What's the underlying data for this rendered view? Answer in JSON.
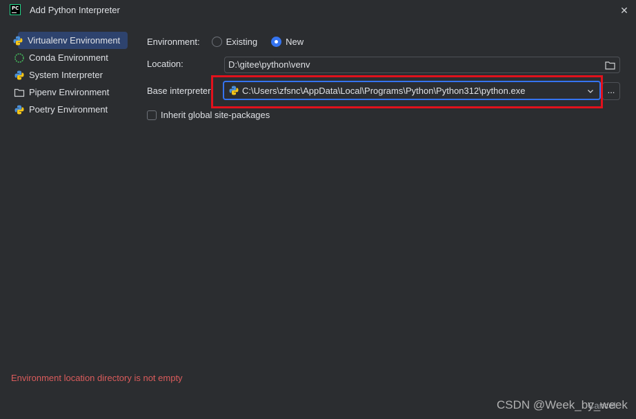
{
  "window": {
    "title": "Add Python Interpreter",
    "app_icon_text": "PC"
  },
  "sidebar": {
    "items": [
      {
        "label": "Virtualenv Environment",
        "icon": "python-env-icon",
        "selected": true
      },
      {
        "label": "Conda Environment",
        "icon": "conda-icon",
        "selected": false
      },
      {
        "label": "System Interpreter",
        "icon": "python-icon",
        "selected": false
      },
      {
        "label": "Pipenv Environment",
        "icon": "pipenv-folder-icon",
        "selected": false
      },
      {
        "label": "Poetry Environment",
        "icon": "poetry-icon",
        "selected": false
      }
    ]
  },
  "form": {
    "environment_label": "Environment:",
    "option_existing": "Existing",
    "option_new": "New",
    "selected_option": "New",
    "location_label": "Location:",
    "location_value": "D:\\gitee\\python\\venv",
    "base_interpreter_label": "Base interpreter:",
    "base_interpreter_value": "C:\\Users\\zfsnc\\AppData\\Local\\Programs\\Python\\Python312\\python.exe",
    "browse_label": "...",
    "inherit_label": "Inherit global site-packages",
    "inherit_checked": false
  },
  "error_message": "Environment location directory is not empty",
  "footer": {
    "watermark": "CSDN @Week_by_week",
    "cancel_label": "Cancel"
  },
  "colors": {
    "background": "#2b2d30",
    "accent": "#3574f0",
    "highlight": "#e2111c",
    "error": "#db5c5c"
  }
}
